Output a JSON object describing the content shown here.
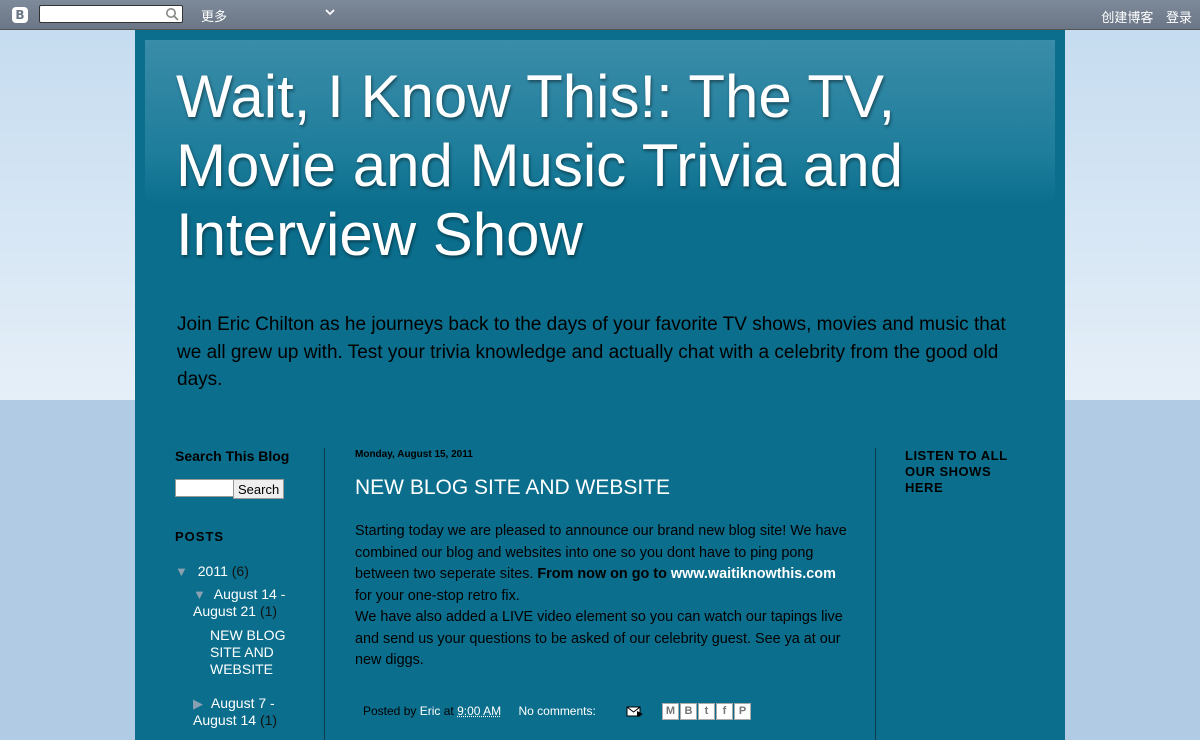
{
  "navbar": {
    "logo": "B",
    "search_placeholder": "",
    "more_label": "更多",
    "create_blog": "创建博客",
    "login": "登录"
  },
  "header": {
    "title": "Wait, I Know This!: The TV, Movie and Music Trivia and Interview Show",
    "description": "Join Eric Chilton as he journeys back to the days of your favorite TV shows, movies and music that we all grew up with. Test your trivia knowledge and actually chat with a celebrity from the good old days."
  },
  "sidebar": {
    "search_title": "Search This Blog",
    "search_button": "Search",
    "posts_title": "POSTS",
    "archive": {
      "year": "2011",
      "year_count": "(6)",
      "week1_label": "August 14 - August 21",
      "week1_count": "(1)",
      "week1_post": "NEW BLOG SITE AND WEBSITE",
      "week2_label": "August 7 - August 14",
      "week2_count": "(1)"
    }
  },
  "post": {
    "date": "Monday, August 15, 2011",
    "title": "NEW BLOG SITE AND WEBSITE",
    "p1_start": "Starting today we are pleased to announce our brand new blog site! We have combined our blog and websites into one so you dont have to ping pong between two seperate sites. ",
    "p1_bold1": "From now on go to ",
    "p1_link": "www.waitiknowthis.com",
    "p1_end": " for your one-stop retro fix.",
    "p2": "We have also added a LIVE video element so you can watch our tapings live and send us your questions to be asked of our celebrity guest. See ya at our new diggs.",
    "posted_by": "Posted by",
    "author": "Eric",
    "at": "at",
    "time": "9:00 AM",
    "comments": "No comments:"
  },
  "right_sidebar": {
    "title": "LISTEN TO ALL OUR SHOWS HERE"
  },
  "colors": {
    "background": "#0b6e8d",
    "navbar": "#6b7686"
  },
  "icons": [
    "blogger-logo-icon",
    "search-icon",
    "chevron-down-icon",
    "email-icon",
    "gmail-share-icon",
    "blogger-share-icon",
    "twitter-share-icon",
    "facebook-share-icon",
    "pinterest-share-icon"
  ]
}
